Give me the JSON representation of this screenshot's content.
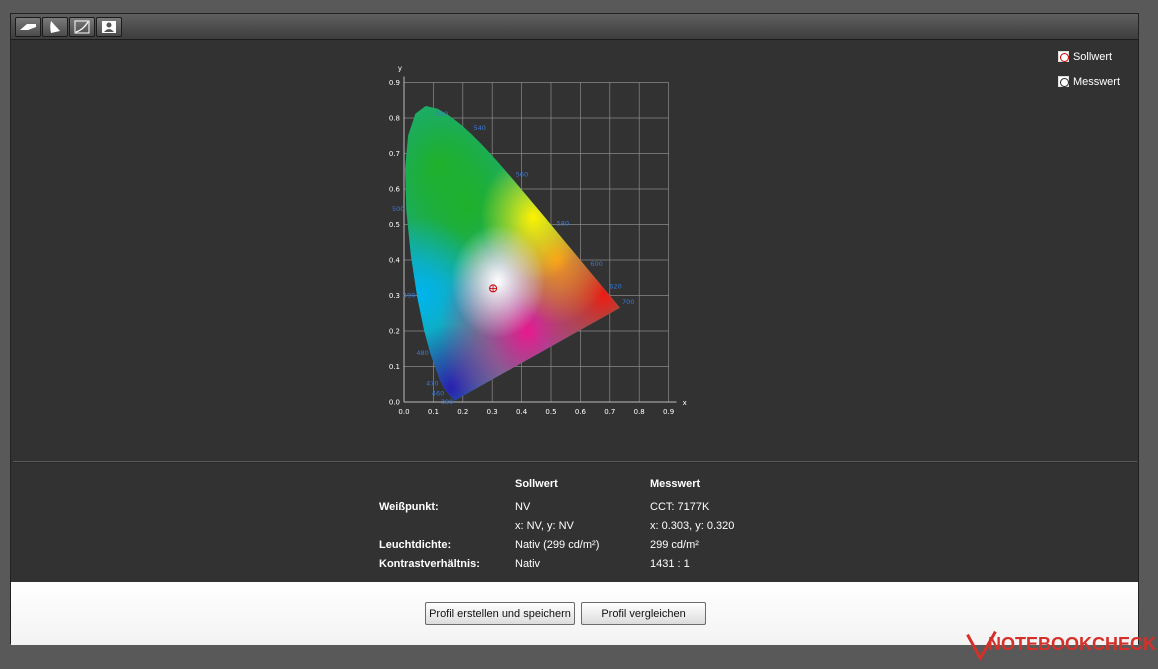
{
  "toolbar": {
    "buttons": [
      {
        "icon": "monitor-tilt-icon"
      },
      {
        "icon": "gamut-triangle-icon"
      },
      {
        "icon": "gamma-curve-icon"
      },
      {
        "icon": "user-portrait-icon"
      }
    ]
  },
  "legend": {
    "target_label": "Sollwert",
    "measured_label": "Messwert"
  },
  "chart_data": {
    "type": "scatter",
    "title": "",
    "xlabel": "x",
    "ylabel": "y",
    "xlim": [
      0.0,
      0.9
    ],
    "ylim": [
      0.0,
      0.9
    ],
    "x_ticks": [
      "0.0",
      "0.1",
      "0.2",
      "0.3",
      "0.4",
      "0.5",
      "0.6",
      "0.7",
      "0.8",
      "0.9"
    ],
    "y_ticks": [
      "0.0",
      "0.1",
      "0.2",
      "0.3",
      "0.4",
      "0.5",
      "0.6",
      "0.7",
      "0.8",
      "0.9"
    ],
    "grid": true,
    "wavelength_labels": [
      {
        "label": "520",
        "x": 0.0743,
        "y": 0.8338
      },
      {
        "label": "540",
        "x": 0.2296,
        "y": 0.7543
      },
      {
        "label": "560",
        "x": 0.3731,
        "y": 0.6245
      },
      {
        "label": "580",
        "x": 0.5125,
        "y": 0.4866
      },
      {
        "label": "600",
        "x": 0.627,
        "y": 0.3725
      },
      {
        "label": "620",
        "x": 0.6915,
        "y": 0.3083
      },
      {
        "label": "700",
        "x": 0.7347,
        "y": 0.2653
      },
      {
        "label": "500",
        "x": 0.0082,
        "y": 0.5384
      },
      {
        "label": "490",
        "x": 0.0454,
        "y": 0.295
      },
      {
        "label": "480",
        "x": 0.0913,
        "y": 0.1327
      },
      {
        "label": "470",
        "x": 0.1241,
        "y": 0.0578
      },
      {
        "label": "460",
        "x": 0.144,
        "y": 0.0297
      },
      {
        "label": "380",
        "x": 0.1741,
        "y": 0.005
      }
    ],
    "series": [
      {
        "name": "Messwert",
        "points": [
          {
            "x": 0.303,
            "y": 0.32
          }
        ]
      }
    ],
    "colors": {
      "target": "#cc0000",
      "measured": "#222222"
    }
  },
  "table": {
    "headers": {
      "target": "Sollwert",
      "measured": "Messwert"
    },
    "rows": [
      {
        "label": "Weißpunkt:",
        "target": "NV",
        "measured": "CCT: 7177K"
      },
      {
        "label": "",
        "target": "x: NV, y: NV",
        "measured": "x: 0.303, y: 0.320"
      },
      {
        "label": "Leuchtdichte:",
        "target": "Nativ (299 cd/m²)",
        "measured": "299 cd/m²"
      },
      {
        "label": "Kontrastverhältnis:",
        "target": "Nativ",
        "measured": "1431 : 1"
      }
    ]
  },
  "actions": {
    "create_save": "Profil erstellen und speichern",
    "compare": "Profil vergleichen"
  },
  "watermark": {
    "brand": "NOTEBOOKCHECK",
    "color": "#d4302a"
  }
}
